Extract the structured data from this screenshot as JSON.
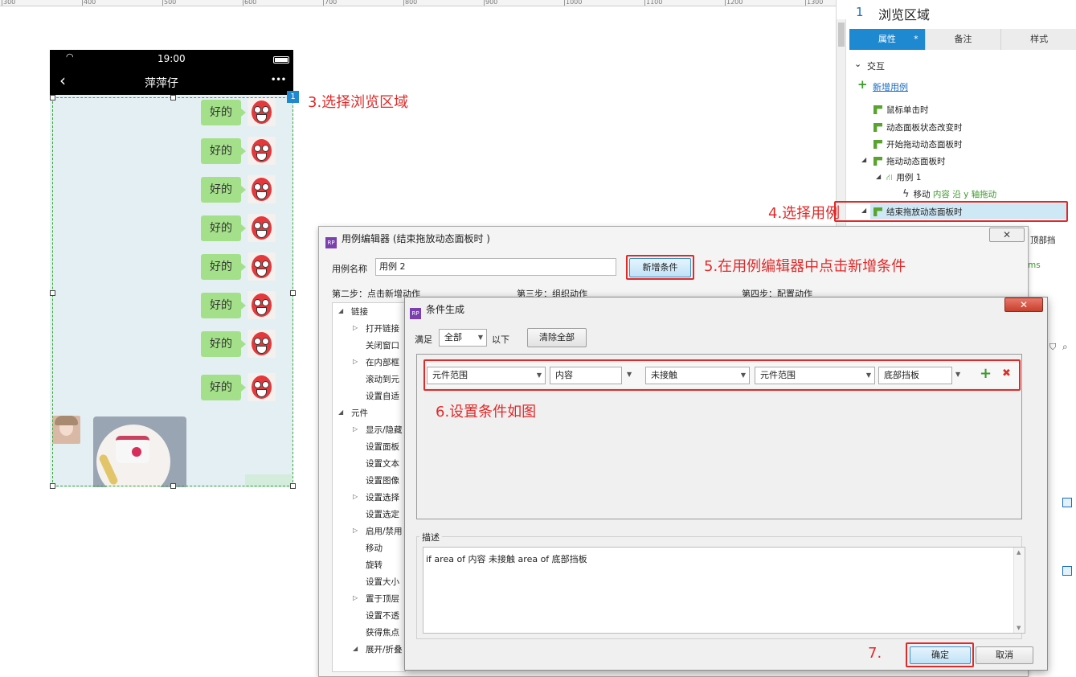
{
  "ruler": {
    "labels": [
      "300",
      "400",
      "500",
      "600",
      "700",
      "800",
      "900",
      "1000",
      "1100",
      "1200",
      "1300"
    ]
  },
  "right_panel": {
    "number": "1",
    "title": "浏览区域",
    "tabs": [
      {
        "label": "属性",
        "mark": "*"
      },
      {
        "label": "备注"
      },
      {
        "label": "样式"
      }
    ],
    "section": "交互",
    "add_case": "新增用例",
    "events": [
      {
        "label": "鼠标单击时"
      },
      {
        "label": "动态面板状态改变时"
      },
      {
        "label": "开始拖动动态面板时"
      },
      {
        "label": "拖动动态面板时"
      }
    ],
    "case_label": "用例 1",
    "action_prefix": "移动 ",
    "action_detail": "内容 沿 y 轴拖动",
    "selected_event": "结束拖放动态面板时",
    "partial_text_1": "顶部挡",
    "partial_text_2": "ms"
  },
  "phone": {
    "time": "19:00",
    "title": "萍萍仔",
    "back": "‹",
    "more": "•••",
    "bubble_text": "好的",
    "bubbles": 8,
    "badge": "1"
  },
  "annotations": {
    "a3": "3.选择浏览区域",
    "a4": "4.选择用例",
    "a5": "5.在用例编辑器中点击新增条件",
    "a6": "6.设置条件如图",
    "a7": "7."
  },
  "case_editor": {
    "rp_badge": "RP",
    "title": "用例编辑器 (结束拖放动态面板时 )",
    "close": "✕",
    "name_label": "用例名称",
    "name_value": "用例 2",
    "add_condition": "新增条件",
    "step2": "第二步：点击新增动作",
    "step3": "第三步：组织动作",
    "step4": "第四步：配置动作",
    "tree": [
      {
        "label": "链接",
        "level": 0,
        "tri": "◢"
      },
      {
        "label": "打开链接",
        "level": 1,
        "tri": "▷"
      },
      {
        "label": "关闭窗口",
        "level": 1,
        "tri": ""
      },
      {
        "label": "在内部框",
        "level": 1,
        "tri": "▷"
      },
      {
        "label": "滚动到元",
        "level": 1,
        "tri": ""
      },
      {
        "label": "设置自适",
        "level": 1,
        "tri": ""
      },
      {
        "label": "元件",
        "level": 0,
        "tri": "◢"
      },
      {
        "label": "显示/隐藏",
        "level": 1,
        "tri": "▷"
      },
      {
        "label": "设置面板",
        "level": 1,
        "tri": ""
      },
      {
        "label": "设置文本",
        "level": 1,
        "tri": ""
      },
      {
        "label": "设置图像",
        "level": 1,
        "tri": ""
      },
      {
        "label": "设置选择",
        "level": 1,
        "tri": "▷"
      },
      {
        "label": "设置选定",
        "level": 1,
        "tri": ""
      },
      {
        "label": "启用/禁用",
        "level": 1,
        "tri": "▷"
      },
      {
        "label": "移动",
        "level": 1,
        "tri": ""
      },
      {
        "label": "旋转",
        "level": 1,
        "tri": ""
      },
      {
        "label": "设置大小",
        "level": 1,
        "tri": ""
      },
      {
        "label": "置于顶层",
        "level": 1,
        "tri": "▷"
      },
      {
        "label": "设置不透",
        "level": 1,
        "tri": ""
      },
      {
        "label": "获得焦点",
        "level": 1,
        "tri": ""
      },
      {
        "label": "展开/折叠",
        "level": 1,
        "tri": "◢"
      }
    ]
  },
  "condition_dialog": {
    "rp_badge": "RP",
    "title": "条件生成",
    "close": "✕",
    "satisfy_label": "满足",
    "satisfy_value": "全部",
    "below_label": "以下",
    "clear_all": "清除全部",
    "row": {
      "sel1": "元件范围",
      "sel2": "内容",
      "sel3": "未接触",
      "sel4": "元件范围",
      "sel5": "底部挡板"
    },
    "add_icon": "+",
    "remove_icon": "✖",
    "desc_label": "描述",
    "desc_text": "if area of 内容 未接触  area of 底部挡板",
    "ok": "确定",
    "cancel": "取消"
  },
  "colors": {
    "accent": "#1e88d0",
    "annotation": "#e02a2a",
    "bubble": "#a4e08a",
    "chat_bg": "#e4eff3"
  }
}
